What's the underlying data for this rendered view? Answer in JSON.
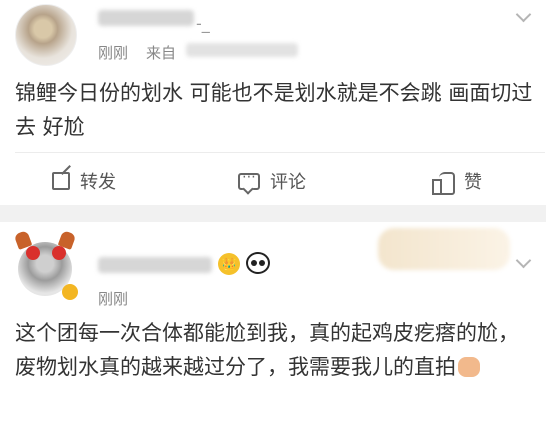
{
  "post": {
    "author_suffix": "-_",
    "time": "刚刚",
    "source_label": "来自",
    "text": "锦鲤今日份的划水 可能也不是划水就是不会跳 画面切过去 好尬",
    "actions": {
      "repost": "转发",
      "comment": "评论",
      "like": "赞"
    }
  },
  "comment": {
    "time": "刚刚",
    "text": "这个团每一次合体都能尬到我，真的起鸡皮疙瘩的尬，废物划水真的越来越过分了，我需要我儿的直拍",
    "crown_emoji": "👑"
  },
  "icons": {
    "repost": "repost-icon",
    "comment": "comment-icon",
    "like": "thumbs-up-icon",
    "more": "chevron-down-icon"
  },
  "colors": {
    "text": "#333333",
    "meta": "#888888",
    "separator": "#f1f1f1"
  }
}
